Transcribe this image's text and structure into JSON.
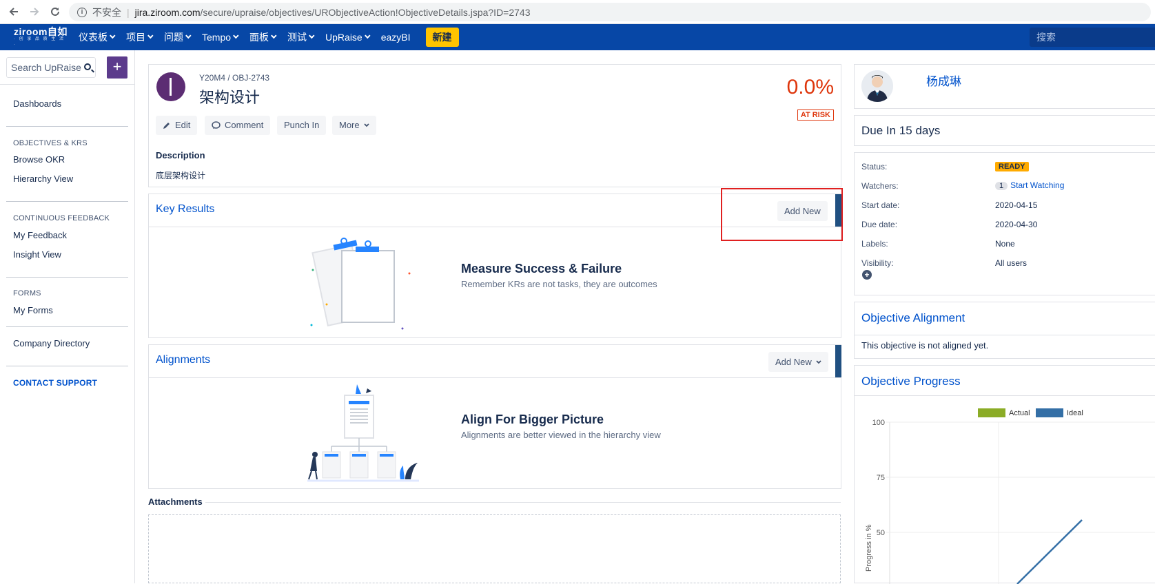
{
  "browser": {
    "insecure_label": "不安全",
    "url_host": "jira.ziroom.com",
    "url_path": "/secure/upraise/objectives/URObjectiveAction!ObjectiveDetails.jspa?ID=2743"
  },
  "header": {
    "logo_main": "ziroom自如",
    "logo_sub": "· 创 享 品 质 生 活 ·",
    "menu": [
      "仪表板",
      "项目",
      "问题",
      "Tempo",
      "面板",
      "测试",
      "UpRaise",
      "eazyBI"
    ],
    "create_label": "新建",
    "search_placeholder": "搜索",
    "bg_color": "#0747a6",
    "create_color": "#ffc400"
  },
  "sidebar": {
    "search_placeholder": "Search UpRaise",
    "plus_label": "+",
    "dashboards": "Dashboards",
    "sections": [
      {
        "heading": "OBJECTIVES & KRS",
        "items": [
          "Browse OKR",
          "Hierarchy View"
        ]
      },
      {
        "heading": "CONTINUOUS FEEDBACK",
        "items": [
          "My Feedback",
          "Insight View"
        ]
      },
      {
        "heading": "FORMS",
        "items": [
          "My Forms"
        ]
      }
    ],
    "company_directory": "Company Directory",
    "contact_support": "CONTACT SUPPORT"
  },
  "objective": {
    "key": "Y20M4 / OBJ-2743",
    "title": "架构设计",
    "progress": "0.0%",
    "risk": "AT RISK",
    "actions": {
      "edit": "Edit",
      "comment": "Comment",
      "punch_in": "Punch In",
      "more": "More"
    },
    "description_heading": "Description",
    "description": "底层架构设计"
  },
  "key_results": {
    "title": "Key Results",
    "add_new": "Add New",
    "empty_heading": "Measure Success & Failure",
    "empty_sub": "Remember KRs are not tasks, they are outcomes"
  },
  "alignments": {
    "title": "Alignments",
    "add_new": "Add New",
    "empty_heading": "Align For Bigger Picture",
    "empty_sub": "Alignments are better viewed in the hierarchy view"
  },
  "attachments": {
    "heading": "Attachments"
  },
  "right": {
    "owner": "杨成琳",
    "due": "Due In 15 days",
    "details": {
      "status_label": "Status:",
      "status": "READY",
      "watchers_label": "Watchers:",
      "watchers_count": "1",
      "watch_link": "Start Watching",
      "start_label": "Start date:",
      "start": "2020-04-15",
      "due_label": "Due date:",
      "due_date": "2020-04-30",
      "labels_label": "Labels:",
      "labels": "None",
      "visibility_label": "Visibility:",
      "visibility": "All users"
    },
    "alignment_title": "Objective Alignment",
    "alignment_text": "This objective is not aligned yet.",
    "progress_title": "Objective Progress"
  },
  "chart_data": {
    "type": "line",
    "title": "",
    "ylabel": "Progress in %",
    "ylim": [
      0,
      100
    ],
    "yticks": [
      100,
      75,
      50
    ],
    "series": [
      {
        "name": "Actual",
        "color": "#8bac26",
        "values": []
      },
      {
        "name": "Ideal",
        "color": "#346fa6",
        "values": []
      }
    ],
    "legend": "top-right"
  }
}
